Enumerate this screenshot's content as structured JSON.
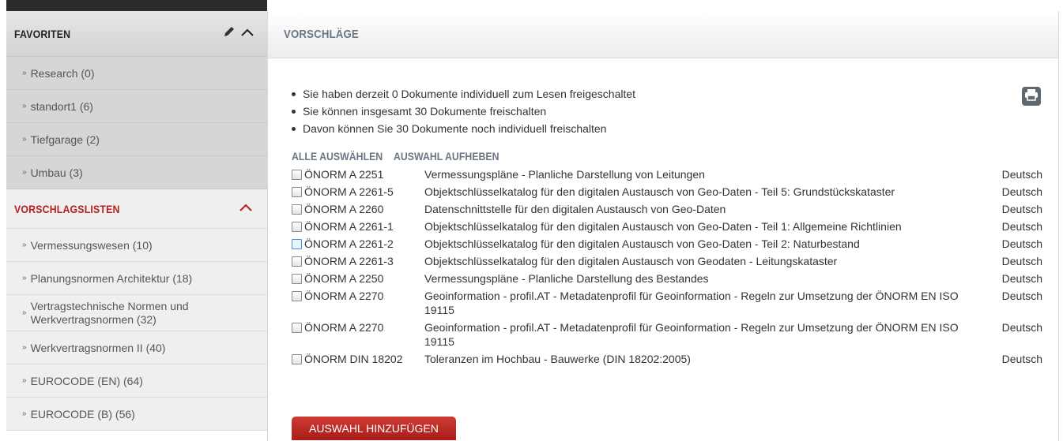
{
  "sidebar": {
    "favoriten": {
      "title": "FAVORITEN",
      "items": [
        {
          "label": "Research (0)"
        },
        {
          "label": "standort1 (6)"
        },
        {
          "label": "Tiefgarage (2)"
        },
        {
          "label": "Umbau (3)"
        }
      ]
    },
    "vorschlagslisten": {
      "title": "VORSCHLAGSLISTEN",
      "items": [
        {
          "label": "Vermessungswesen (10)"
        },
        {
          "label": "Planungsnormen Architektur (18)"
        },
        {
          "label": "Vertragstechnische Normen und Werkvertragsnormen (32)"
        },
        {
          "label": "Werkvertragsnormen II (40)"
        },
        {
          "label": "EUROCODE (EN) (64)"
        },
        {
          "label": "EUROCODE (B) (56)"
        }
      ]
    }
  },
  "main": {
    "title": "VORSCHLÄGE",
    "info": [
      "Sie haben derzeit 0 Dokumente individuell zum Lesen freigeschaltet",
      "Sie können insgesamt 30 Dokumente freischalten",
      "Davon können Sie 30 Dokumente noch individuell freischalten"
    ],
    "select_all": "ALLE AUSWÄHLEN",
    "deselect": "AUSWAHL AUFHEBEN",
    "documents": [
      {
        "code": "ÖNORM A 2251",
        "title": "Vermessungspläne - Planliche Darstellung von Leitungen",
        "lang": "Deutsch"
      },
      {
        "code": "ÖNORM A 2261-5",
        "title": "Objektschlüsselkatalog für den digitalen Austausch von Geo-Daten - Teil 5: Grundstückskataster",
        "lang": "Deutsch"
      },
      {
        "code": "ÖNORM A 2260",
        "title": "Datenschnittstelle für den digitalen Austausch von Geo-Daten",
        "lang": "Deutsch"
      },
      {
        "code": "ÖNORM A 2261-1",
        "title": "Objektschlüsselkatalog für den digitalen Austausch von Geo-Daten - Teil 1: Allgemeine Richtlinien",
        "lang": "Deutsch"
      },
      {
        "code": "ÖNORM A 2261-2",
        "title": "Objektschlüsselkatalog für den digitalen Austausch von Geo-Daten - Teil 2: Naturbestand",
        "lang": "Deutsch"
      },
      {
        "code": "ÖNORM A 2261-3",
        "title": "Objektschlüsselkatalog für den digitalen Austausch von Geodaten - Leitungskataster",
        "lang": "Deutsch"
      },
      {
        "code": "ÖNORM A 2250",
        "title": "Vermessungspläne - Planliche Darstellung des Bestandes",
        "lang": "Deutsch"
      },
      {
        "code": "ÖNORM A 2270",
        "title": "Geoinformation - profil.AT - Metadatenprofil für Geoinformation - Regeln zur Umsetzung der ÖNORM EN ISO 19115",
        "lang": "Deutsch"
      },
      {
        "code": "ÖNORM A 2270",
        "title": "Geoinformation - profil.AT - Metadatenprofil für Geoinformation - Regeln zur Umsetzung der ÖNORM EN ISO 19115",
        "lang": "Deutsch"
      },
      {
        "code": "ÖNORM DIN 18202",
        "title": "Toleranzen im Hochbau - Bauwerke (DIN 18202:2005)",
        "lang": "Deutsch"
      }
    ],
    "add_button": "AUSWAHL HINZUFÜGEN"
  }
}
